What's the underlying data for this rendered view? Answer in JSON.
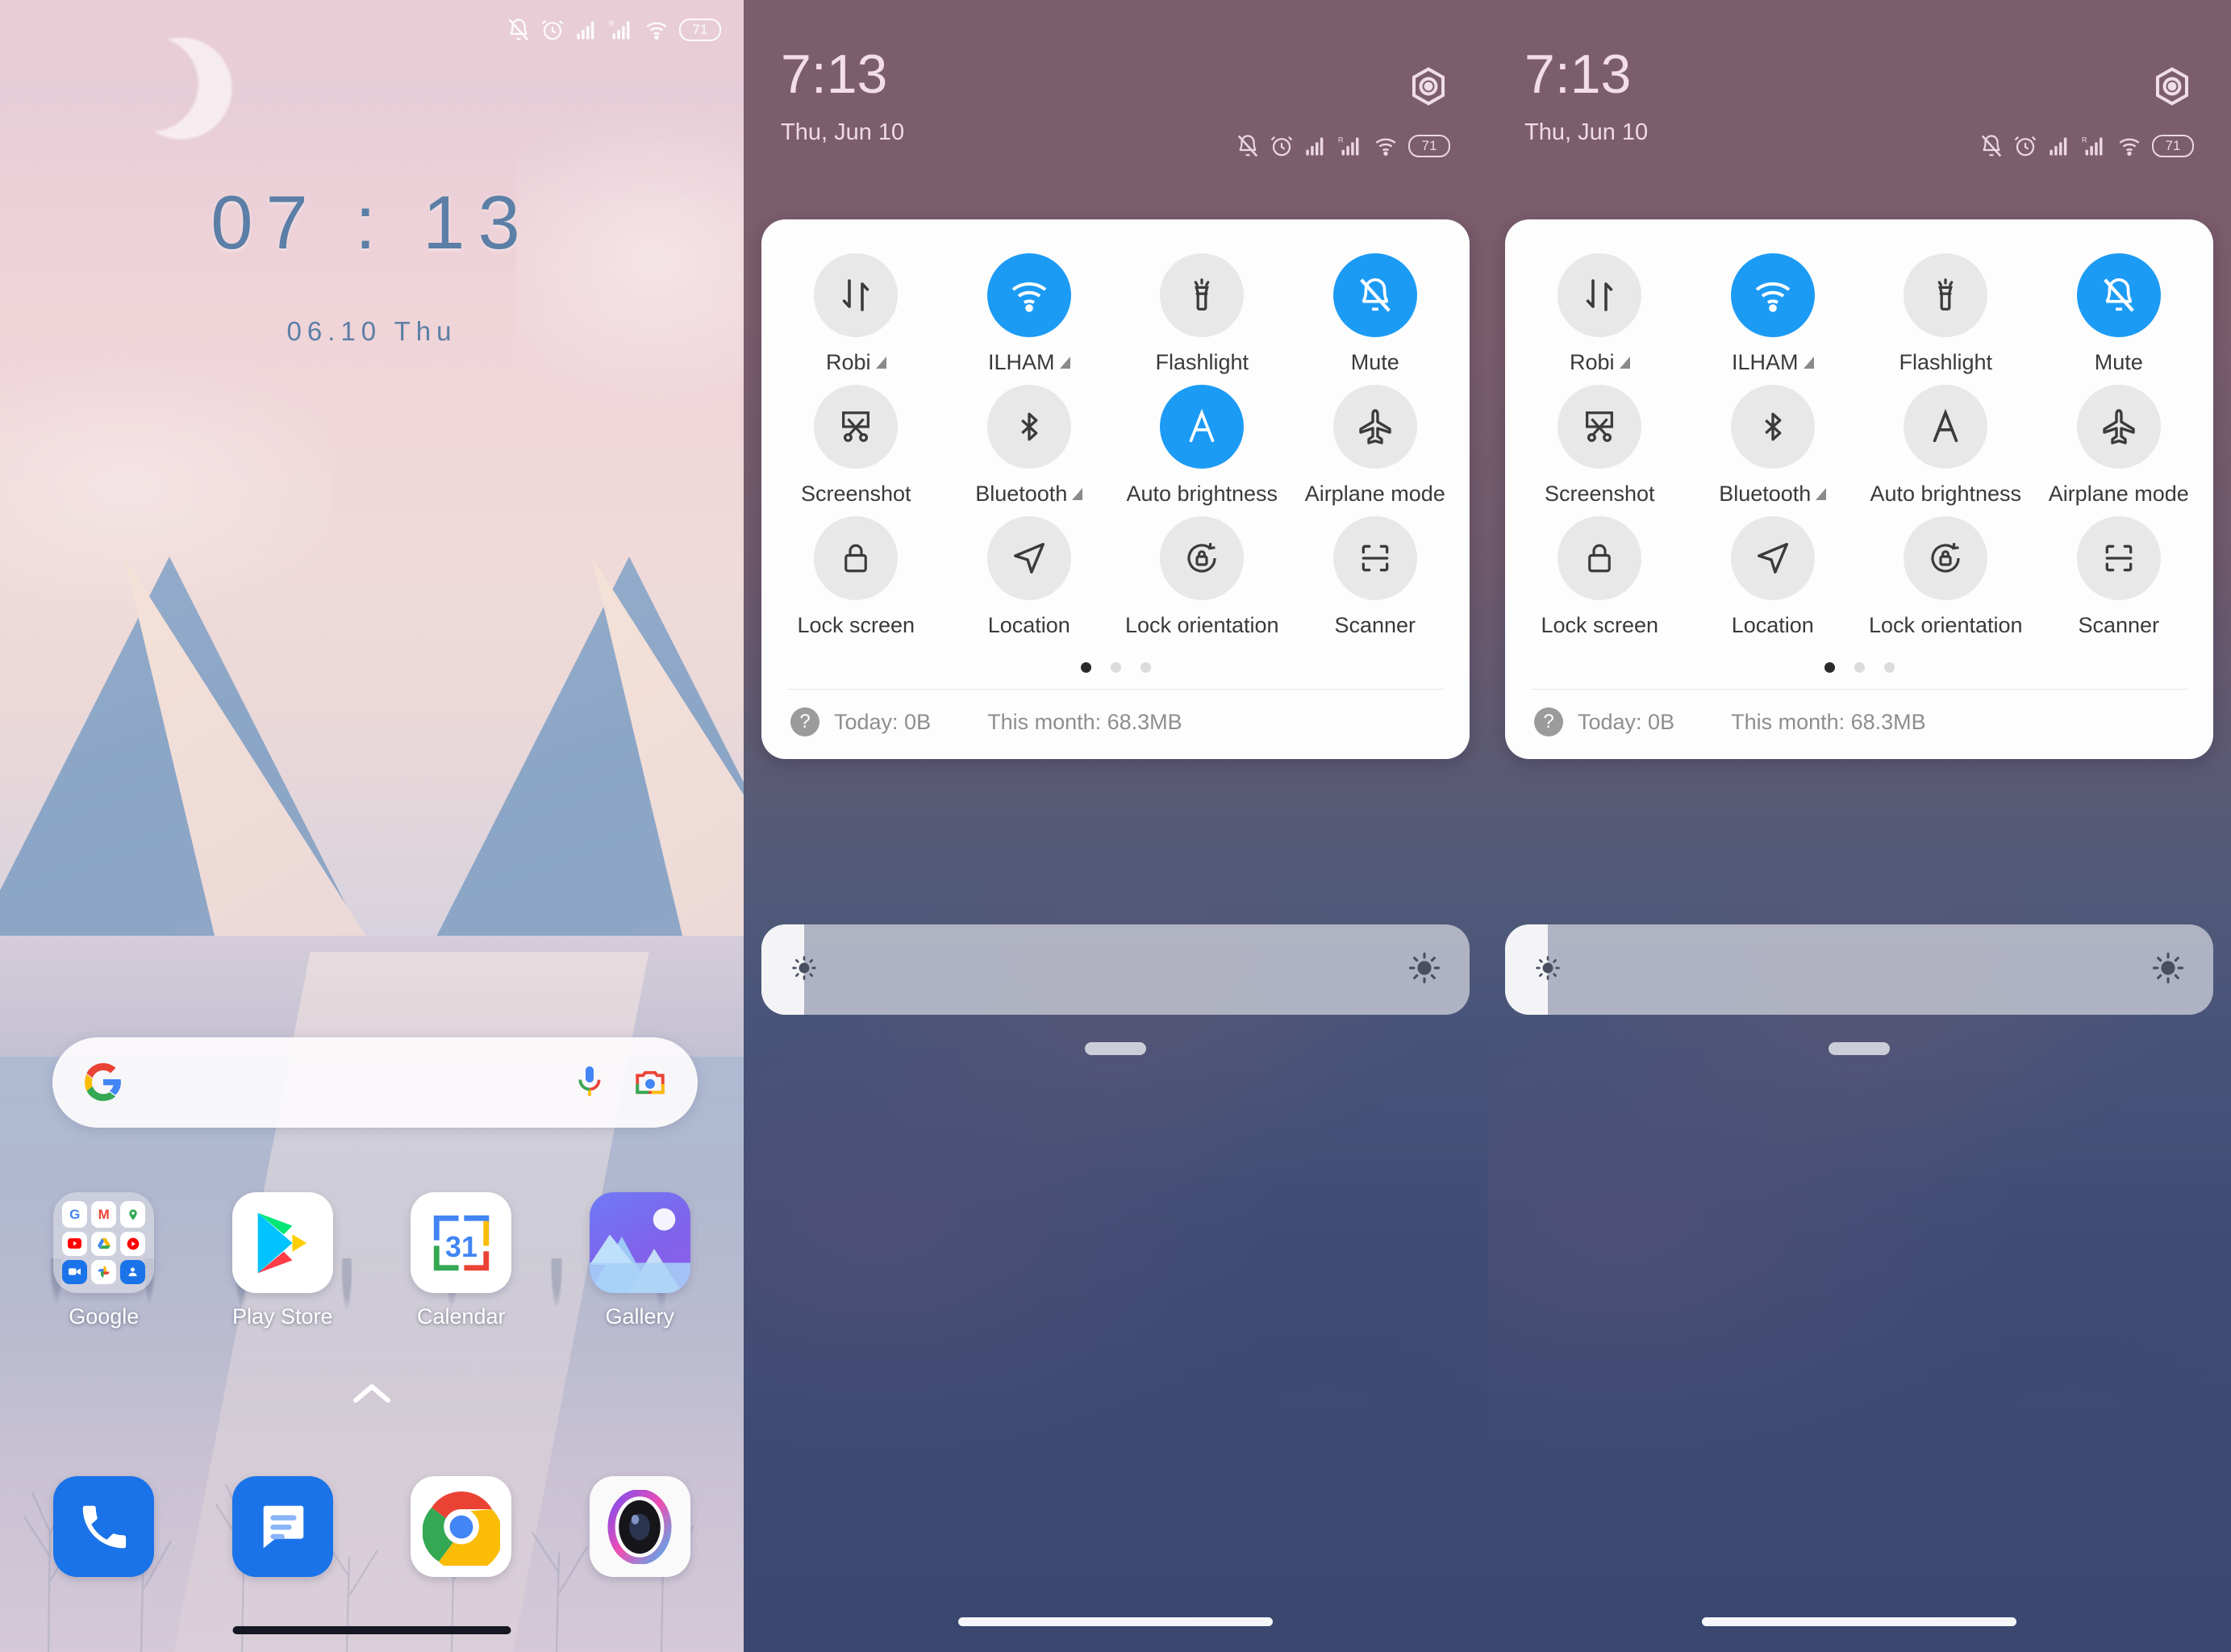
{
  "home_screen": {
    "status_bar": {
      "icons": [
        "mute-bell-icon",
        "alarm-icon",
        "signal-sim1-icon",
        "signal-sim2-roaming-icon",
        "wifi-icon",
        "battery-icon"
      ],
      "battery_level": "71"
    },
    "clock": "07 : 13",
    "date": "06.10  Thu",
    "search": {
      "placeholder": "",
      "logo": "google-g-icon",
      "mic": "microphone-icon",
      "lens": "google-lens-icon"
    },
    "apps": [
      {
        "label": "Google",
        "icon": "google-folder-icon"
      },
      {
        "label": "Play Store",
        "icon": "play-store-icon"
      },
      {
        "label": "Calendar",
        "icon": "calendar-icon",
        "day": "31"
      },
      {
        "label": "Gallery",
        "icon": "gallery-icon"
      }
    ],
    "app_drawer_chevron": "chevron-up-icon",
    "dock": [
      {
        "label": "Phone",
        "icon": "phone-icon"
      },
      {
        "label": "Messages",
        "icon": "messages-icon"
      },
      {
        "label": "Chrome",
        "icon": "chrome-icon"
      },
      {
        "label": "Camera",
        "icon": "camera-icon"
      }
    ]
  },
  "quick_settings_a": {
    "time": "7:13",
    "date": "Thu, Jun 10",
    "settings_icon": "hexagon-gear-icon",
    "status_icons": [
      "mute-bell-icon",
      "alarm-icon",
      "signal-sim1-icon",
      "signal-sim2-roaming-icon",
      "wifi-icon",
      "battery-icon"
    ],
    "battery_level": "71",
    "tiles": [
      {
        "label": "Robi",
        "icon": "mobile-data-icon",
        "state": "off",
        "arrow": true
      },
      {
        "label": "ILHAM",
        "icon": "wifi-icon",
        "state": "on",
        "arrow": true
      },
      {
        "label": "Flashlight",
        "icon": "flashlight-icon",
        "state": "off",
        "arrow": false
      },
      {
        "label": "Mute",
        "icon": "bell-mute-icon",
        "state": "on",
        "arrow": false
      },
      {
        "label": "Screenshot",
        "icon": "screenshot-icon",
        "state": "off",
        "arrow": false
      },
      {
        "label": "Bluetooth",
        "icon": "bluetooth-icon",
        "state": "off",
        "arrow": true
      },
      {
        "label": "Auto brightness",
        "icon": "auto-brightness-icon",
        "state": "on",
        "arrow": false
      },
      {
        "label": "Airplane mode",
        "icon": "airplane-icon",
        "state": "off",
        "arrow": false
      },
      {
        "label": "Lock screen",
        "icon": "lock-icon",
        "state": "off",
        "arrow": false
      },
      {
        "label": "Location",
        "icon": "location-arrow-icon",
        "state": "off",
        "arrow": false
      },
      {
        "label": "Lock orientation",
        "icon": "rotation-lock-icon",
        "state": "off",
        "arrow": false
      },
      {
        "label": "Scanner",
        "icon": "scanner-frame-icon",
        "state": "off",
        "arrow": false
      }
    ],
    "page_dots": {
      "count": 3,
      "active_index": 0
    },
    "usage": {
      "help_icon": "question-mark-icon",
      "today": "Today: 0B",
      "month": "This month: 68.3MB"
    },
    "brightness": {
      "low_icon": "brightness-low-icon",
      "high_icon": "brightness-high-icon",
      "fill_percent": 6
    }
  },
  "quick_settings_b": {
    "time": "7:13",
    "date": "Thu, Jun 10",
    "settings_icon": "hexagon-gear-icon",
    "status_icons": [
      "mute-bell-icon",
      "alarm-icon",
      "signal-sim1-icon",
      "signal-sim2-roaming-icon",
      "wifi-icon",
      "battery-icon"
    ],
    "battery_level": "71",
    "tiles": [
      {
        "label": "Robi",
        "icon": "mobile-data-icon",
        "state": "off",
        "arrow": true
      },
      {
        "label": "ILHAM",
        "icon": "wifi-icon",
        "state": "on",
        "arrow": true
      },
      {
        "label": "Flashlight",
        "icon": "flashlight-icon",
        "state": "off",
        "arrow": false
      },
      {
        "label": "Mute",
        "icon": "bell-mute-icon",
        "state": "on",
        "arrow": false
      },
      {
        "label": "Screenshot",
        "icon": "screenshot-icon",
        "state": "off",
        "arrow": false
      },
      {
        "label": "Bluetooth",
        "icon": "bluetooth-icon",
        "state": "off",
        "arrow": true
      },
      {
        "label": "Auto brightness",
        "icon": "auto-brightness-icon",
        "state": "off",
        "arrow": false
      },
      {
        "label": "Airplane mode",
        "icon": "airplane-icon",
        "state": "off",
        "arrow": false
      },
      {
        "label": "Lock screen",
        "icon": "lock-icon",
        "state": "off",
        "arrow": false
      },
      {
        "label": "Location",
        "icon": "location-arrow-icon",
        "state": "off",
        "arrow": false
      },
      {
        "label": "Lock orientation",
        "icon": "rotation-lock-icon",
        "state": "off",
        "arrow": false
      },
      {
        "label": "Scanner",
        "icon": "scanner-frame-icon",
        "state": "off",
        "arrow": false
      }
    ],
    "page_dots": {
      "count": 3,
      "active_index": 0
    },
    "usage": {
      "help_icon": "question-mark-icon",
      "today": "Today: 0B",
      "month": "This month: 68.3MB"
    },
    "brightness": {
      "low_icon": "brightness-low-icon",
      "high_icon": "brightness-high-icon",
      "fill_percent": 6
    }
  },
  "colors": {
    "tile_on": "#1c9bf5",
    "tile_off": "#e8e8e8",
    "clock_home": "#5b7fa6",
    "card_bg": "#fdfdfd"
  }
}
